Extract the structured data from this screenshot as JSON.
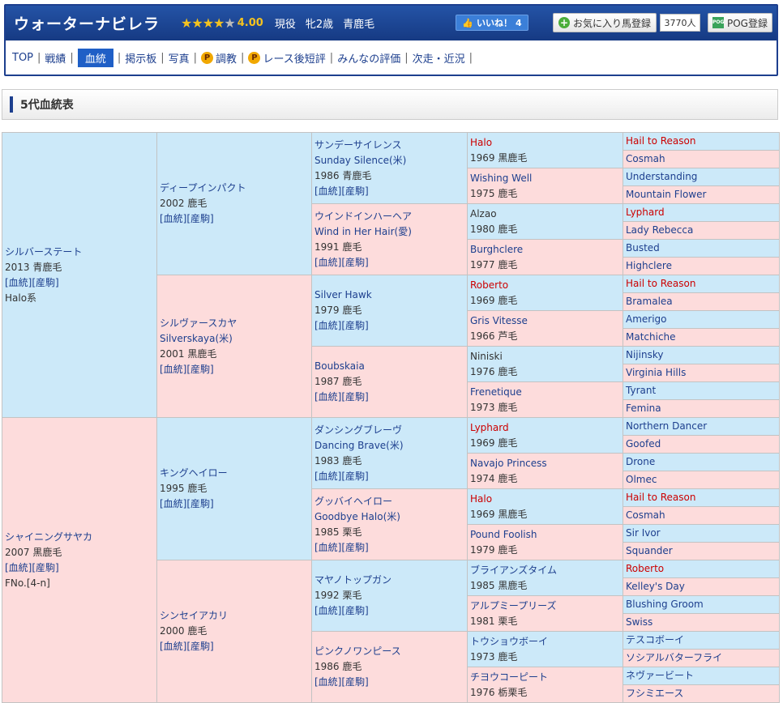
{
  "header": {
    "horse_name": "ウォーターナビレラ",
    "rating": "4.00",
    "status": "現役",
    "sex_age": "牝2歳",
    "coat": "青鹿毛",
    "like_label": "いいね！",
    "like_count": "4",
    "favorite_label": "お気に入り馬登録",
    "favorite_count": "3770人",
    "pog_label": "POG登録",
    "pog_icon_text": "POG"
  },
  "nav": [
    {
      "label": "TOP",
      "active": false,
      "p": false
    },
    {
      "label": "戦績",
      "active": false,
      "p": false
    },
    {
      "label": "血統",
      "active": true,
      "p": false
    },
    {
      "label": "掲示板",
      "active": false,
      "p": false
    },
    {
      "label": "写真",
      "active": false,
      "p": false
    },
    {
      "label": "調教",
      "active": false,
      "p": true
    },
    {
      "label": "レース後短評",
      "active": false,
      "p": true
    },
    {
      "label": "みんなの評価",
      "active": false,
      "p": false
    },
    {
      "label": "次走・近況",
      "active": false,
      "p": false
    }
  ],
  "section_title": "5代血統表",
  "pedigree": {
    "gen1": [
      {
        "name": "シルバーステート",
        "year": "2013",
        "coat": "青鹿毛",
        "links": "[血統][産駒]",
        "extra": "Halo系"
      },
      {
        "name": "シャイニングサヤカ",
        "year": "2007",
        "coat": "黒鹿毛",
        "links": "[血統][産駒]",
        "extra": "FNo.[4-n]"
      }
    ],
    "gen2": [
      {
        "name": "ディープインパクト",
        "year": "2002",
        "coat": "鹿毛",
        "links": "[血統][産駒]"
      },
      {
        "name": "シルヴァースカヤ",
        "sub": "Silverskaya(米)",
        "year": "2001",
        "coat": "黒鹿毛",
        "links": "[血統][産駒]"
      },
      {
        "name": "キングヘイロー",
        "year": "1995",
        "coat": "鹿毛",
        "links": "[血統][産駒]"
      },
      {
        "name": "シンセイアカリ",
        "year": "2000",
        "coat": "鹿毛",
        "links": "[血統][産駒]"
      }
    ],
    "gen3": [
      {
        "name": "サンデーサイレンス",
        "sub": "Sunday Silence(米)",
        "year": "1986",
        "coat": "青鹿毛",
        "links": "[血統][産駒]"
      },
      {
        "name": "ウインドインハーヘア",
        "sub": "Wind in Her Hair(愛)",
        "year": "1991",
        "coat": "鹿毛",
        "links": "[血統][産駒]"
      },
      {
        "name": "Silver Hawk",
        "year": "1979",
        "coat": "鹿毛",
        "links": "[血統][産駒]"
      },
      {
        "name": "Boubskaia",
        "year": "1987",
        "coat": "鹿毛",
        "links": "[血統][産駒]"
      },
      {
        "name": "ダンシングブレーヴ",
        "sub": "Dancing Brave(米)",
        "year": "1983",
        "coat": "鹿毛",
        "links": "[血統][産駒]"
      },
      {
        "name": "グッバイヘイロー",
        "sub": "Goodbye Halo(米)",
        "year": "1985",
        "coat": "栗毛",
        "links": "[血統][産駒]"
      },
      {
        "name": "マヤノトップガン",
        "year": "1992",
        "coat": "栗毛",
        "links": "[血統][産駒]"
      },
      {
        "name": "ピンクノワンピース",
        "year": "1986",
        "coat": "鹿毛",
        "links": "[血統][産駒]"
      }
    ],
    "gen4": [
      {
        "name": "Halo",
        "year": "1969",
        "coat": "黒鹿毛"
      },
      {
        "name": "Wishing Well",
        "year": "1975",
        "coat": "鹿毛"
      },
      {
        "name": "Alzao",
        "year": "1980",
        "coat": "鹿毛"
      },
      {
        "name": "Burghclere",
        "year": "1977",
        "coat": "鹿毛"
      },
      {
        "name": "Roberto",
        "year": "1969",
        "coat": "鹿毛"
      },
      {
        "name": "Gris Vitesse",
        "year": "1966",
        "coat": "芦毛"
      },
      {
        "name": "Niniski",
        "year": "1976",
        "coat": "鹿毛"
      },
      {
        "name": "Frenetique",
        "year": "1973",
        "coat": "鹿毛"
      },
      {
        "name": "Lyphard",
        "year": "1969",
        "coat": "鹿毛"
      },
      {
        "name": "Navajo Princess",
        "year": "1974",
        "coat": "鹿毛"
      },
      {
        "name": "Halo",
        "year": "1969",
        "coat": "黒鹿毛"
      },
      {
        "name": "Pound Foolish",
        "year": "1979",
        "coat": "鹿毛"
      },
      {
        "name": "ブライアンズタイム",
        "year": "1985",
        "coat": "黒鹿毛"
      },
      {
        "name": "アルプミープリーズ",
        "year": "1981",
        "coat": "栗毛"
      },
      {
        "name": "トウショウボーイ",
        "year": "1973",
        "coat": "鹿毛"
      },
      {
        "name": "チヨウコーピート",
        "year": "1976",
        "coat": "栃栗毛"
      }
    ],
    "gen5": [
      "Hail to Reason",
      "Cosmah",
      "Understanding",
      "Mountain Flower",
      "Lyphard",
      "Lady Rebecca",
      "Busted",
      "Highclere",
      "Hail to Reason",
      "Bramalea",
      "Amerigo",
      "Matchiche",
      "Nijinsky",
      "Virginia Hills",
      "Tyrant",
      "Femina",
      "Northern Dancer",
      "Goofed",
      "Drone",
      "Olmec",
      "Hail to Reason",
      "Cosmah",
      "Sir Ivor",
      "Squander",
      "Roberto",
      "Kelley's Day",
      "Blushing Groom",
      "Swiss",
      "テスコボーイ",
      "ソシアルバターフライ",
      "ネヴァービート",
      "フシミエース"
    ]
  },
  "colors": {
    "male_bg": "#cce9f9",
    "female_bg": "#fddcdc",
    "header_bg": "#1d3f8e",
    "link": "#1d3f8e",
    "red_name": "#cc0000"
  }
}
